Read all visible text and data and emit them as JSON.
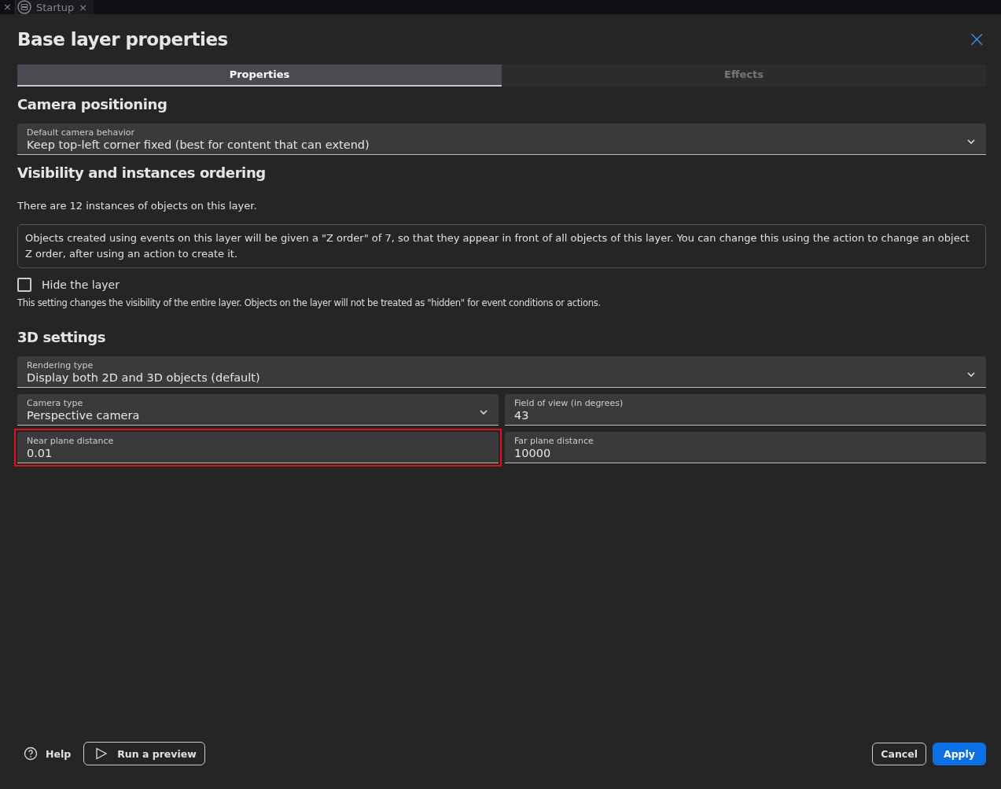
{
  "editor_tabs": {
    "leading_close": "×",
    "tabs": [
      {
        "label": "Startup",
        "close": "×"
      }
    ]
  },
  "dialog": {
    "title": "Base layer properties",
    "close": "×",
    "tabs": [
      {
        "label": "Properties",
        "selected": true
      },
      {
        "label": "Effects",
        "selected": false
      }
    ],
    "camera_section": {
      "heading": "Camera positioning",
      "fields": [
        [
          {
            "kind": "select",
            "label": "Default camera behavior",
            "value": "Keep top-left corner fixed (best for content that can extend)",
            "highlighted": false
          }
        ]
      ]
    },
    "visibility_section": {
      "heading": "Visibility and instances ordering",
      "instances_text": "There are 12 instances of objects on this layer.",
      "info_box": "Objects created using events on this layer will be given a \"Z order\" of 7, so that they appear in front of all objects of this layer. You can change this using the action to change an object Z order, after using an action to create it.",
      "hide_checkbox": {
        "label": "Hide the layer",
        "checked": false
      },
      "hide_help": "This setting changes the visibility of the entire layer. Objects on the layer will not be treated as \"hidden\" for event conditions or actions."
    },
    "settings_3d": {
      "heading": "3D settings",
      "fields": [
        [
          {
            "kind": "select",
            "label": "Rendering type",
            "value": "Display both 2D and 3D objects (default)",
            "highlighted": false
          }
        ],
        [
          {
            "kind": "select",
            "label": "Camera type",
            "value": "Perspective camera",
            "highlighted": false
          },
          {
            "kind": "text",
            "label": "Field of view (in degrees)",
            "value": "43",
            "highlighted": false
          }
        ],
        [
          {
            "kind": "text",
            "label": "Near plane distance",
            "value": "0.01",
            "highlighted": true
          },
          {
            "kind": "text",
            "label": "Far plane distance",
            "value": "10000",
            "highlighted": false
          }
        ]
      ]
    },
    "footer": {
      "help": "Help",
      "preview": "Run a preview",
      "cancel": "Cancel",
      "apply": "Apply"
    }
  }
}
